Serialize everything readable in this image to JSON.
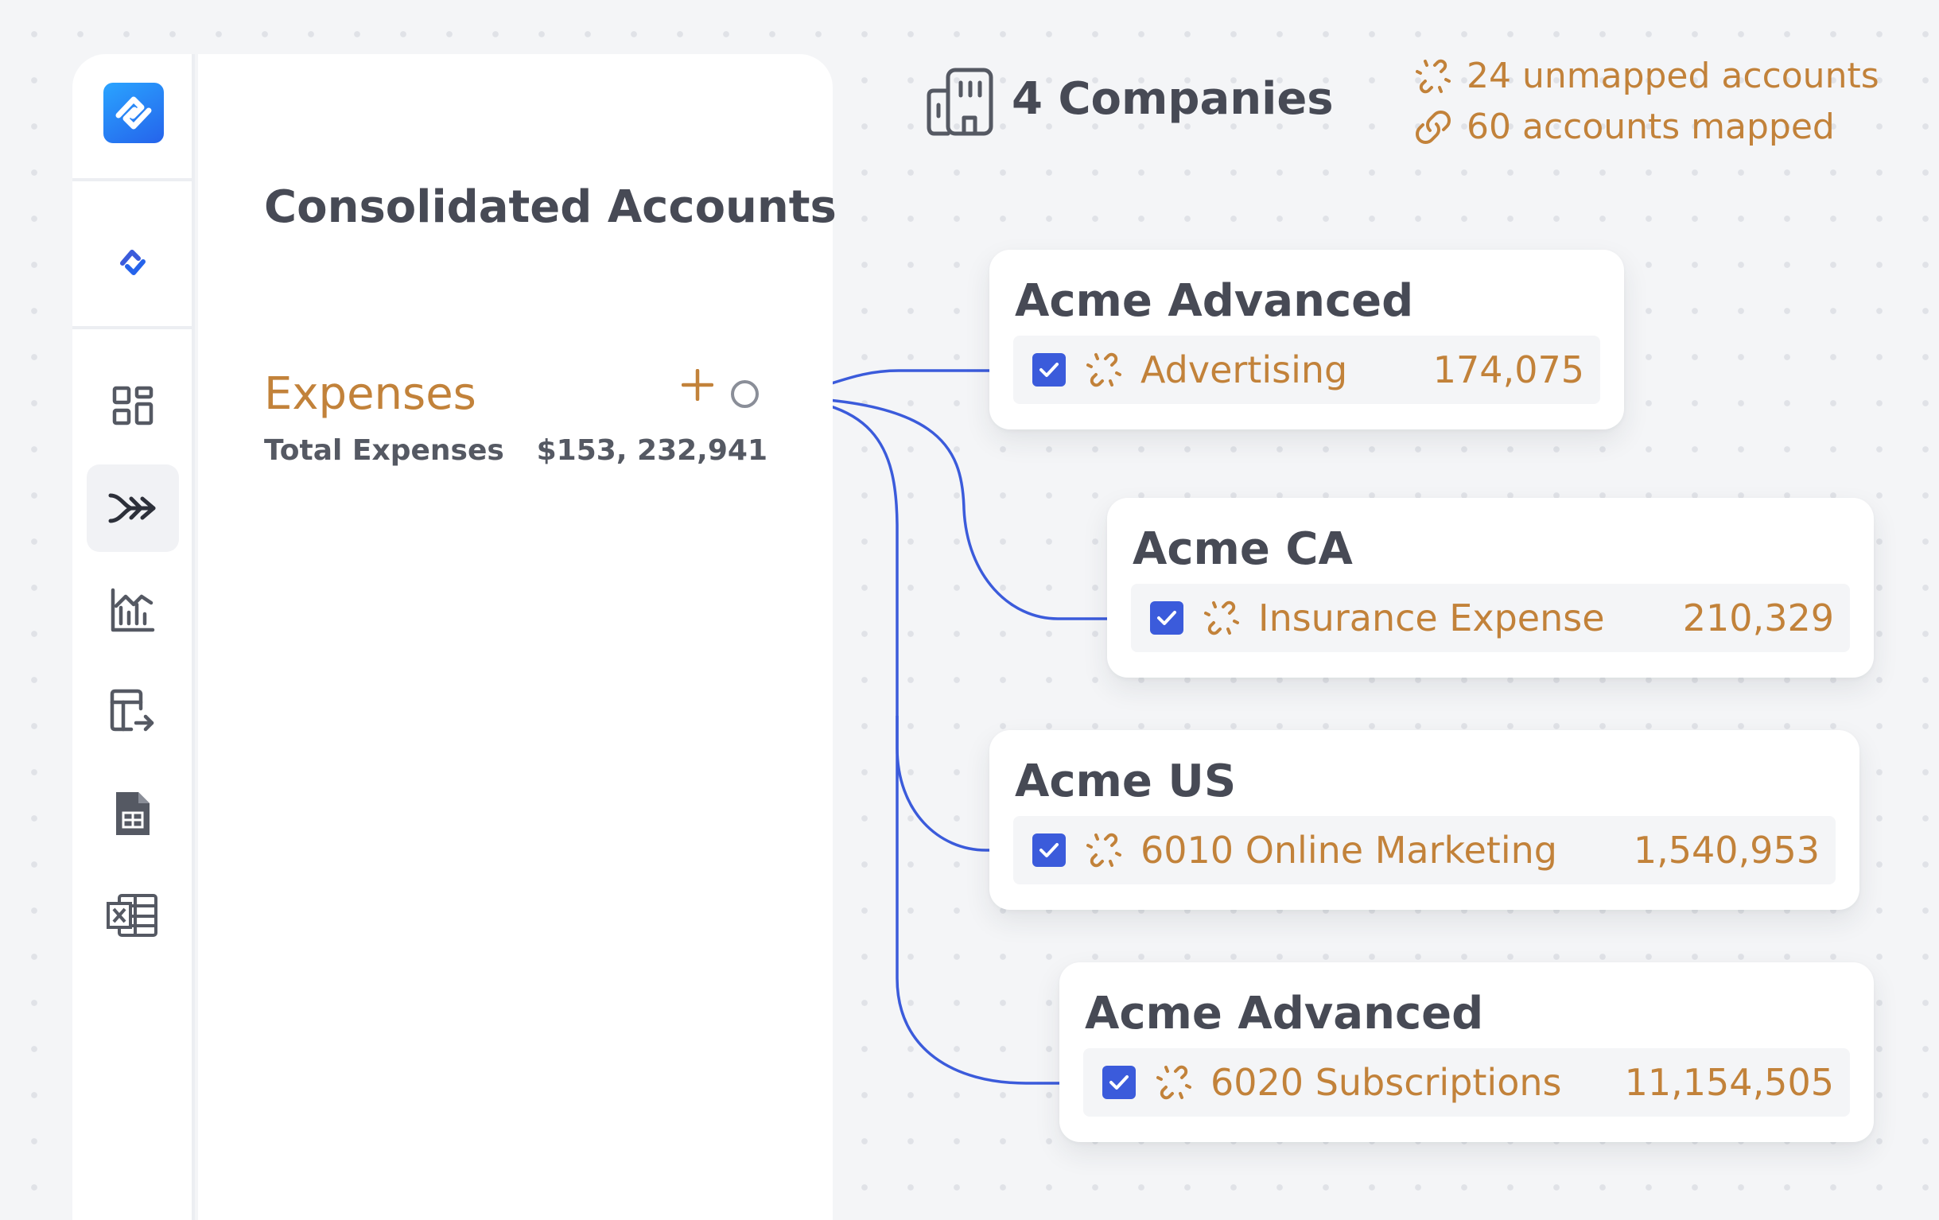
{
  "header": {
    "companies_label": "4 Companies",
    "unmapped_label": "24 unmapped accounts",
    "mapped_label": "60 accounts mapped",
    "accent_color": "#c2823a"
  },
  "sidebar": {
    "logo": "app-logo",
    "items": [
      {
        "icon": "grid-icon"
      },
      {
        "icon": "merge-arrows-icon",
        "active": true
      },
      {
        "icon": "bar-chart-icon"
      },
      {
        "icon": "table-export-icon"
      },
      {
        "icon": "spreadsheet-file-icon"
      },
      {
        "icon": "excel-icon"
      }
    ]
  },
  "panel": {
    "title": "Consolidated Accounts",
    "category": "Expenses",
    "total_label": "Total Expenses",
    "total_value": "$153, 232,941"
  },
  "mappings": [
    {
      "company": "Acme Advanced",
      "account": "Advertising",
      "amount": "174,075",
      "checked": true
    },
    {
      "company": "Acme CA",
      "account": "Insurance Expense",
      "amount": "210,329",
      "checked": true
    },
    {
      "company": "Acme US",
      "account": "6010 Online Marketing",
      "amount": "1,540,953",
      "checked": true
    },
    {
      "company": "Acme Advanced",
      "account": "6020 Subscriptions",
      "amount": "11,154,505",
      "checked": true
    }
  ],
  "colors": {
    "link": "#3b5bdb",
    "checkbox": "#3b5bdb",
    "accent": "#c2823a"
  }
}
